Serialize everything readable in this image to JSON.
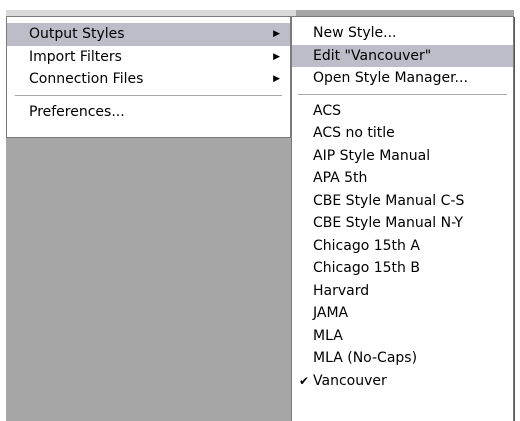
{
  "main_menu": {
    "items": [
      {
        "label": "Output Styles",
        "arrow": "▶"
      },
      {
        "label": "Import Filters",
        "arrow": "▶"
      },
      {
        "label": "Connection Files",
        "arrow": "▶"
      }
    ],
    "preferences_label": "Preferences..."
  },
  "sub_menu": {
    "actions": [
      {
        "label": "New Style..."
      },
      {
        "label": "Edit \"Vancouver\""
      },
      {
        "label": "Open Style Manager..."
      }
    ],
    "styles": [
      {
        "label": "ACS"
      },
      {
        "label": "ACS no title"
      },
      {
        "label": "AIP Style Manual"
      },
      {
        "label": "APA 5th"
      },
      {
        "label": "CBE Style Manual C-S"
      },
      {
        "label": "CBE Style Manual N-Y"
      },
      {
        "label": "Chicago 15th A"
      },
      {
        "label": "Chicago 15th B"
      },
      {
        "label": "Harvard"
      },
      {
        "label": "JAMA"
      },
      {
        "label": "MLA"
      },
      {
        "label": "MLA (No-Caps)"
      },
      {
        "label": "Vancouver",
        "check": "✔"
      }
    ]
  },
  "colors": {
    "highlight": "#bdbdc9",
    "background": "#a6a6a6"
  },
  "icons": {
    "submenu_arrow": "triangle-right-icon",
    "checked": "checkmark-icon"
  }
}
